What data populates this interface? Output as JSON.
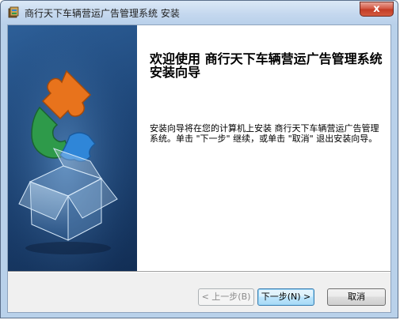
{
  "window": {
    "title": "商行天下车辆营运广告管理系统 安装",
    "close_label": "x"
  },
  "content": {
    "heading": "欢迎使用 商行天下车辆营运广告管理系统 安装向导",
    "description": "安装向导将在您的计算机上安装 商行天下车辆营运广告管理系统。单击 \"下一步\" 继续，或单击 \"取消\" 退出安装向导。"
  },
  "buttons": {
    "back": "< 上一步(B)",
    "next": "下一步(N) >",
    "cancel": "取消"
  },
  "colors": {
    "banner_top": "#2d5f98",
    "banner_bottom": "#122e55",
    "puzzle_orange": "#e8731c",
    "puzzle_green": "#2e9a4a",
    "puzzle_blue": "#2f86d8"
  },
  "icons": {
    "title": "installer-icon",
    "banner": "puzzle-box-illustration"
  }
}
